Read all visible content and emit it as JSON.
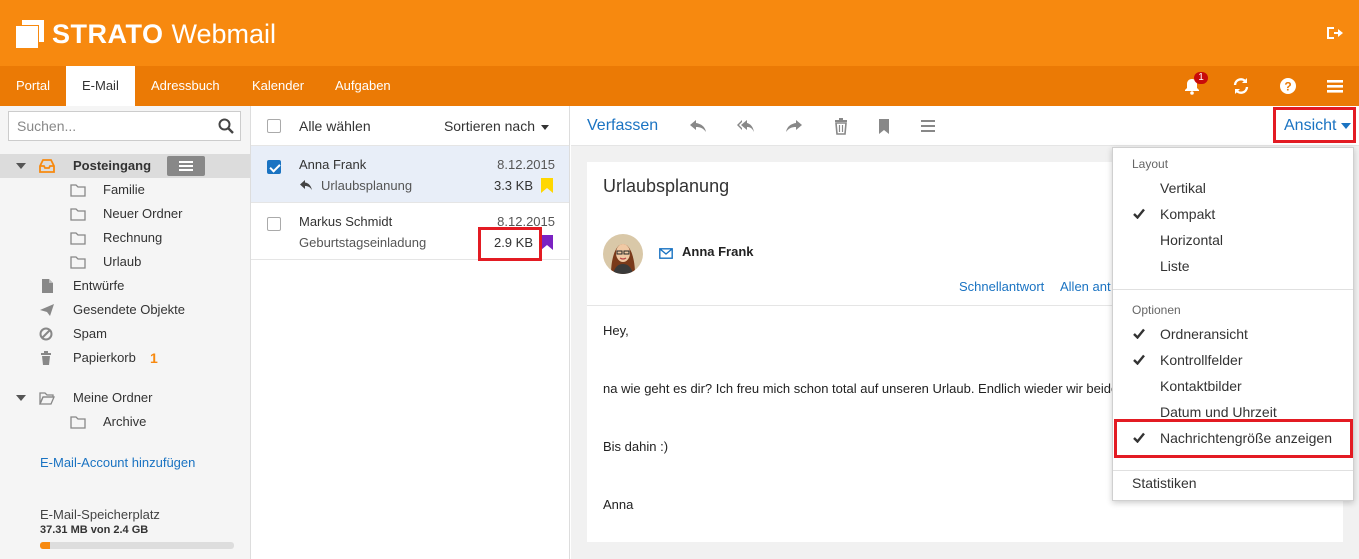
{
  "app": {
    "brand": "STRATO",
    "product": "Webmail",
    "accent": "#f7890f",
    "link_color": "#1a73c2",
    "highlight_color": "#e31b23"
  },
  "nav": {
    "items": [
      "Portal",
      "E-Mail",
      "Adressbuch",
      "Kalender",
      "Aufgaben"
    ],
    "active": "E-Mail",
    "notification_count": "1",
    "icons": [
      "bell-icon",
      "refresh-icon",
      "help-icon",
      "menu-icon"
    ]
  },
  "search": {
    "placeholder": "Suchen..."
  },
  "folders": {
    "inbox": "Posteingang",
    "inbox_sub": [
      "Familie",
      "Neuer Ordner",
      "Rechnung",
      "Urlaub"
    ],
    "drafts": "Entwürfe",
    "sent": "Gesendete Objekte",
    "spam": "Spam",
    "trash": "Papierkorb",
    "trash_count": "1",
    "my_folders": "Meine Ordner",
    "archive": "Archive",
    "add_account": "E-Mail-Account hinzufügen",
    "storage_label": "E-Mail-Speicherplatz",
    "storage_value": "37.31 MB von 2.4 GB",
    "storage_fraction": 0.015
  },
  "list": {
    "select_all": "Alle wählen",
    "sort_by": "Sortieren nach",
    "messages": [
      {
        "sender": "Anna Frank",
        "date": "8.12.2015",
        "subject": "Urlaubsplanung",
        "size": "3.3 KB",
        "selected": true,
        "replied": true,
        "flag_color": "#ffd700"
      },
      {
        "sender": "Markus Schmidt",
        "date": "8.12.2015",
        "subject": "Geburtstagseinladung",
        "size": "2.9 KB",
        "selected": false,
        "replied": false,
        "flag_color": "#7b22c2"
      }
    ]
  },
  "reader": {
    "compose": "Verfassen",
    "view_menu": "Ansicht",
    "subject": "Urlaubsplanung",
    "from": "Anna Frank",
    "quick_reply": "Schnellantwort",
    "reply_all": "Allen ant",
    "body": [
      "Hey,",
      "na wie geht es dir? Ich freu mich schon total auf unseren Urlaub. Endlich wieder wir beide",
      "Bis dahin :)",
      "Anna"
    ]
  },
  "view_dropdown": {
    "layout_head": "Layout",
    "layout_items": [
      {
        "label": "Vertikal",
        "checked": false
      },
      {
        "label": "Kompakt",
        "checked": true
      },
      {
        "label": "Horizontal",
        "checked": false
      },
      {
        "label": "Liste",
        "checked": false
      }
    ],
    "options_head": "Optionen",
    "option_items": [
      {
        "label": "Ordneransicht",
        "checked": true
      },
      {
        "label": "Kontrollfelder",
        "checked": true
      },
      {
        "label": "Kontaktbilder",
        "checked": false
      },
      {
        "label": "Datum und Uhrzeit",
        "checked": false
      },
      {
        "label": "Nachrichtengröße anzeigen",
        "checked": true
      }
    ],
    "statistics": "Statistiken"
  }
}
